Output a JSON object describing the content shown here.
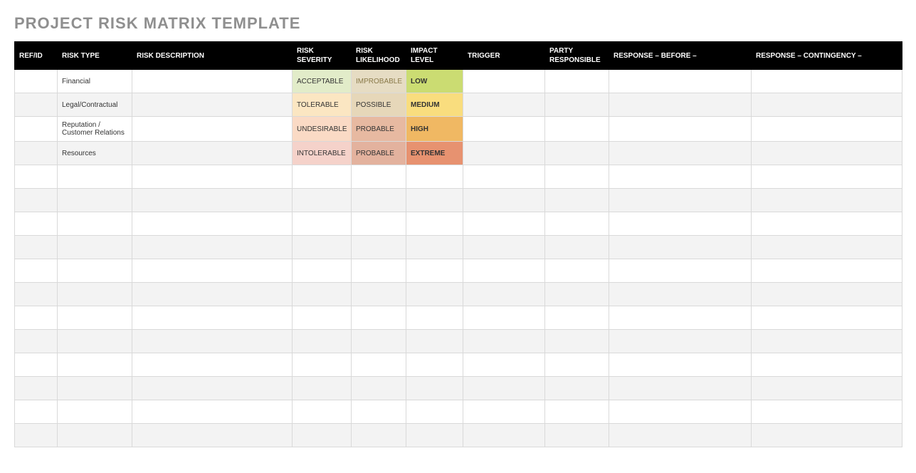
{
  "title": "PROJECT RISK MATRIX TEMPLATE",
  "headers": {
    "ref": "REF/ID",
    "type": "RISK TYPE",
    "desc": "RISK DESCRIPTION",
    "sev": "RISK SEVERITY",
    "lik": "RISK LIKELIHOOD",
    "imp": "IMPACT LEVEL",
    "trg": "TRIGGER",
    "party": "PARTY RESPONSIBLE",
    "before": "RESPONSE – BEFORE –",
    "cont": "RESPONSE – CONTINGENCY –"
  },
  "rows": [
    {
      "ref": "",
      "type": "Financial",
      "desc": "",
      "sev": "ACCEPTABLE",
      "sev_cls": "sev-acceptable",
      "lik": "IMPROBABLE",
      "lik_cls": "lik-improbable",
      "imp": "LOW",
      "imp_cls": "imp-low",
      "trg": "",
      "party": "",
      "before": "",
      "cont": "",
      "alt": false
    },
    {
      "ref": "",
      "type": "Legal/Contractual",
      "desc": "",
      "sev": "TOLERABLE",
      "sev_cls": "sev-tolerable",
      "lik": "POSSIBLE",
      "lik_cls": "lik-possible",
      "imp": "MEDIUM",
      "imp_cls": "imp-medium",
      "trg": "",
      "party": "",
      "before": "",
      "cont": "",
      "alt": true
    },
    {
      "ref": "",
      "type": "Reputation / Customer Relations",
      "desc": "",
      "sev": "UNDESIRABLE",
      "sev_cls": "sev-undesirable",
      "lik": "PROBABLE",
      "lik_cls": "lik-probable1",
      "imp": "HIGH",
      "imp_cls": "imp-high",
      "trg": "",
      "party": "",
      "before": "",
      "cont": "",
      "alt": false
    },
    {
      "ref": "",
      "type": "Resources",
      "desc": "",
      "sev": "INTOLERABLE",
      "sev_cls": "sev-intolerable",
      "lik": "PROBABLE",
      "lik_cls": "lik-probable2",
      "imp": "EXTREME",
      "imp_cls": "imp-extreme",
      "trg": "",
      "party": "",
      "before": "",
      "cont": "",
      "alt": true
    },
    {
      "ref": "",
      "type": "",
      "desc": "",
      "sev": "",
      "sev_cls": "",
      "lik": "",
      "lik_cls": "",
      "imp": "",
      "imp_cls": "",
      "trg": "",
      "party": "",
      "before": "",
      "cont": "",
      "alt": false
    },
    {
      "ref": "",
      "type": "",
      "desc": "",
      "sev": "",
      "sev_cls": "",
      "lik": "",
      "lik_cls": "",
      "imp": "",
      "imp_cls": "",
      "trg": "",
      "party": "",
      "before": "",
      "cont": "",
      "alt": true
    },
    {
      "ref": "",
      "type": "",
      "desc": "",
      "sev": "",
      "sev_cls": "",
      "lik": "",
      "lik_cls": "",
      "imp": "",
      "imp_cls": "",
      "trg": "",
      "party": "",
      "before": "",
      "cont": "",
      "alt": false
    },
    {
      "ref": "",
      "type": "",
      "desc": "",
      "sev": "",
      "sev_cls": "",
      "lik": "",
      "lik_cls": "",
      "imp": "",
      "imp_cls": "",
      "trg": "",
      "party": "",
      "before": "",
      "cont": "",
      "alt": true
    },
    {
      "ref": "",
      "type": "",
      "desc": "",
      "sev": "",
      "sev_cls": "",
      "lik": "",
      "lik_cls": "",
      "imp": "",
      "imp_cls": "",
      "trg": "",
      "party": "",
      "before": "",
      "cont": "",
      "alt": false
    },
    {
      "ref": "",
      "type": "",
      "desc": "",
      "sev": "",
      "sev_cls": "",
      "lik": "",
      "lik_cls": "",
      "imp": "",
      "imp_cls": "",
      "trg": "",
      "party": "",
      "before": "",
      "cont": "",
      "alt": true
    },
    {
      "ref": "",
      "type": "",
      "desc": "",
      "sev": "",
      "sev_cls": "",
      "lik": "",
      "lik_cls": "",
      "imp": "",
      "imp_cls": "",
      "trg": "",
      "party": "",
      "before": "",
      "cont": "",
      "alt": false
    },
    {
      "ref": "",
      "type": "",
      "desc": "",
      "sev": "",
      "sev_cls": "",
      "lik": "",
      "lik_cls": "",
      "imp": "",
      "imp_cls": "",
      "trg": "",
      "party": "",
      "before": "",
      "cont": "",
      "alt": true
    },
    {
      "ref": "",
      "type": "",
      "desc": "",
      "sev": "",
      "sev_cls": "",
      "lik": "",
      "lik_cls": "",
      "imp": "",
      "imp_cls": "",
      "trg": "",
      "party": "",
      "before": "",
      "cont": "",
      "alt": false
    },
    {
      "ref": "",
      "type": "",
      "desc": "",
      "sev": "",
      "sev_cls": "",
      "lik": "",
      "lik_cls": "",
      "imp": "",
      "imp_cls": "",
      "trg": "",
      "party": "",
      "before": "",
      "cont": "",
      "alt": true
    },
    {
      "ref": "",
      "type": "",
      "desc": "",
      "sev": "",
      "sev_cls": "",
      "lik": "",
      "lik_cls": "",
      "imp": "",
      "imp_cls": "",
      "trg": "",
      "party": "",
      "before": "",
      "cont": "",
      "alt": false
    },
    {
      "ref": "",
      "type": "",
      "desc": "",
      "sev": "",
      "sev_cls": "",
      "lik": "",
      "lik_cls": "",
      "imp": "",
      "imp_cls": "",
      "trg": "",
      "party": "",
      "before": "",
      "cont": "",
      "alt": true
    }
  ]
}
